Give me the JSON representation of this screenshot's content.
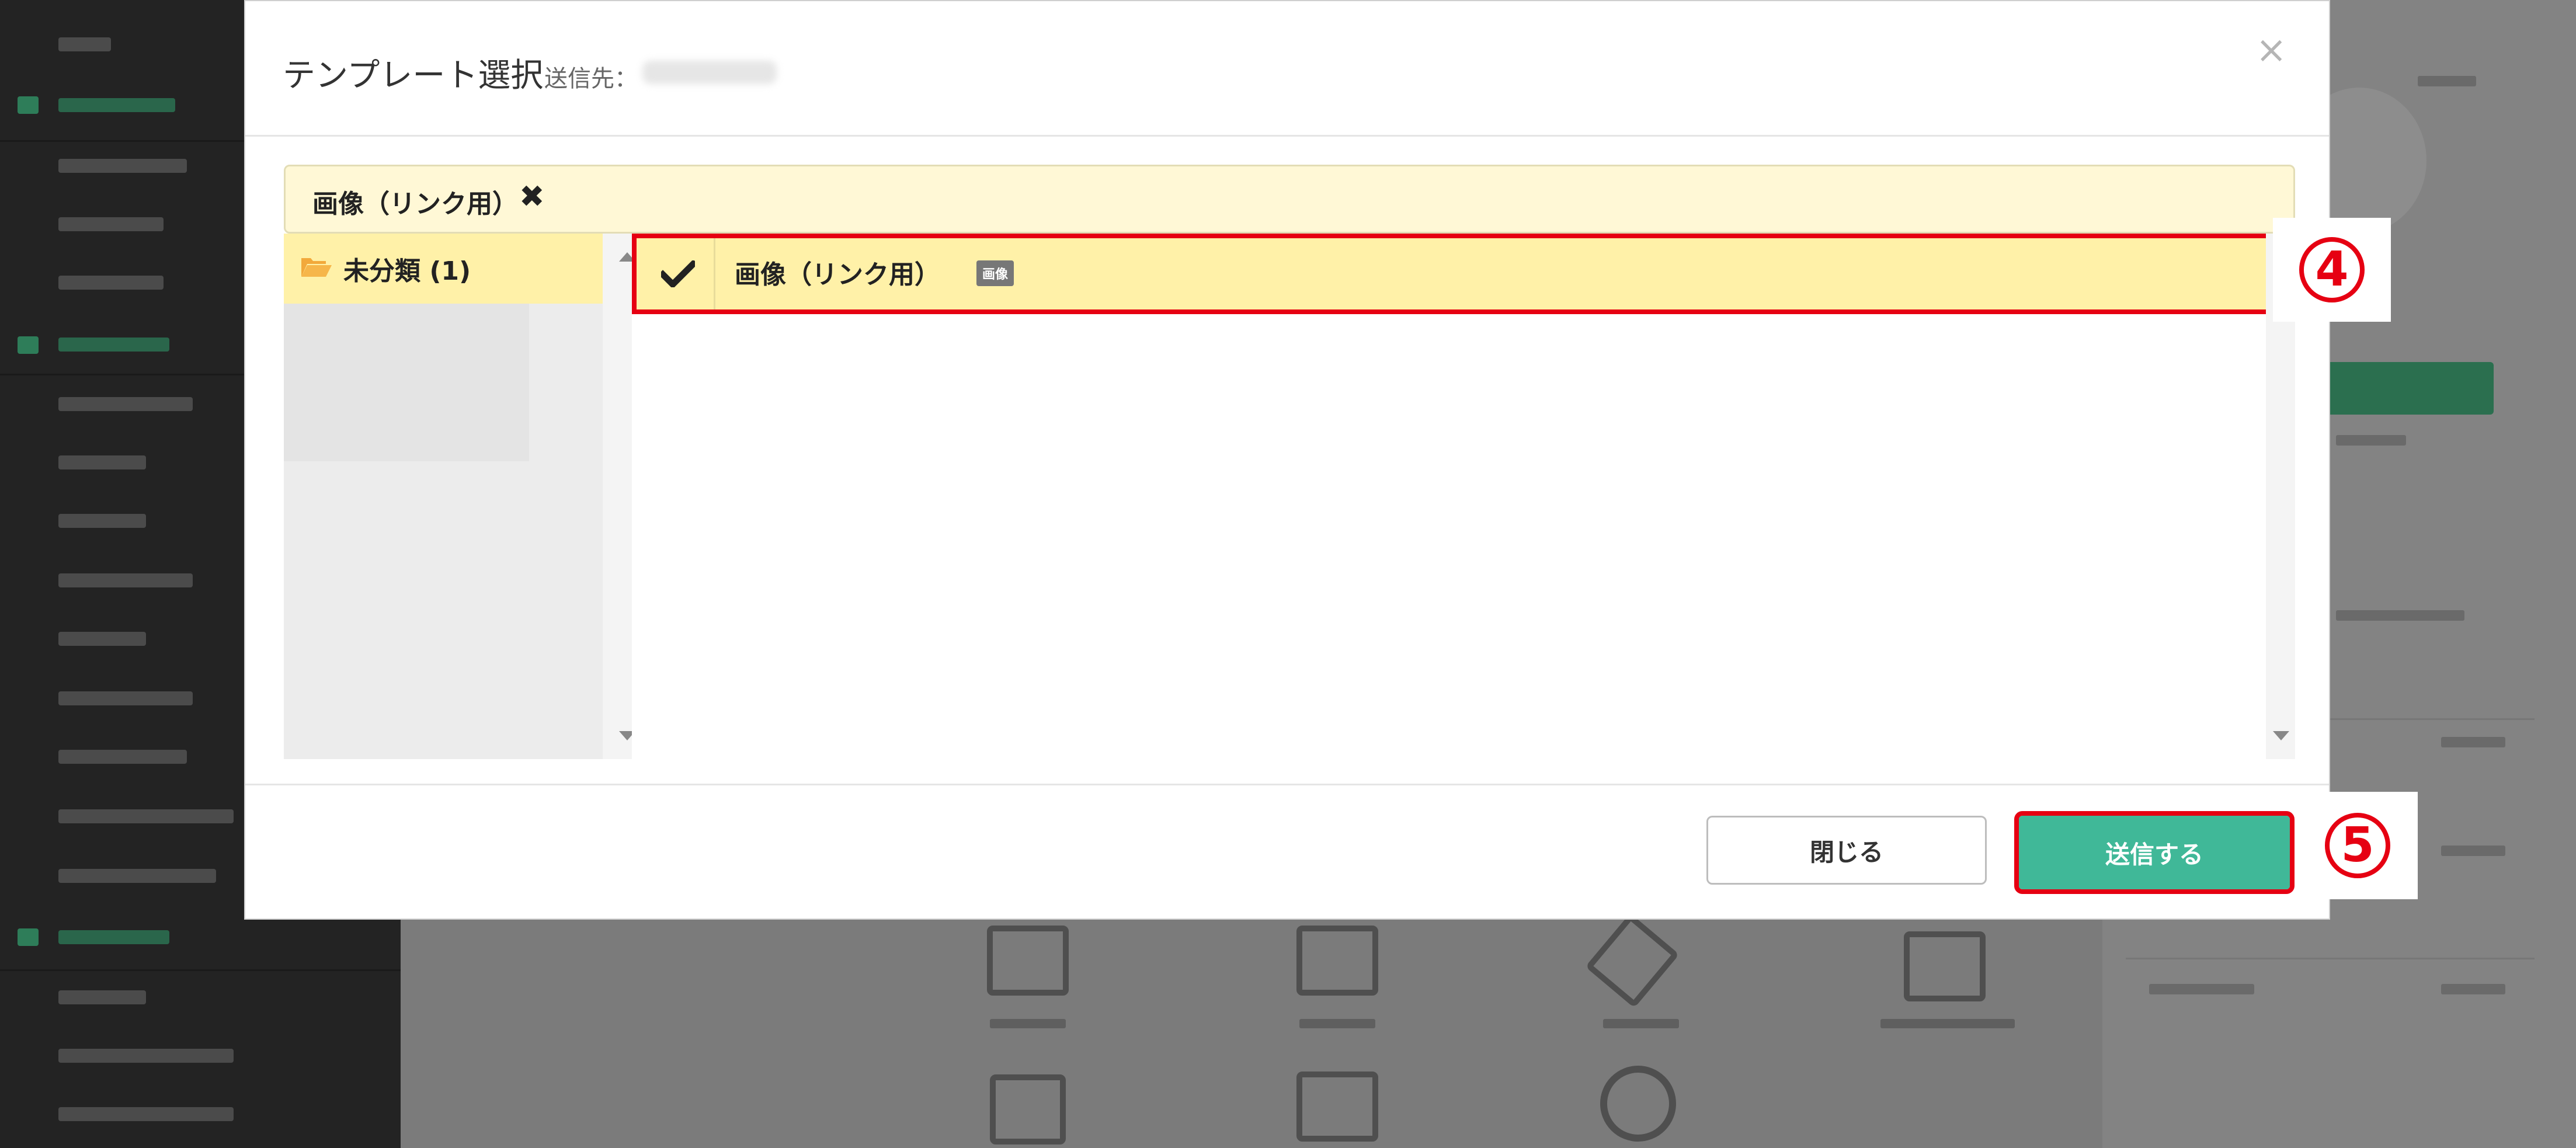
{
  "modal": {
    "title": "テンプレート選択",
    "subtitle": "送信先：",
    "close_glyph": "×"
  },
  "selected": {
    "label": "画像（リンク用）",
    "remove_glyph": "✖"
  },
  "folders": [
    {
      "label": "未分類 (1)"
    }
  ],
  "templates": [
    {
      "label": "画像（リンク用）",
      "badge": "画像",
      "checked": true
    }
  ],
  "footer": {
    "close_label": "閉じる",
    "send_label": "送信する"
  },
  "callouts": {
    "step4": "4",
    "step5": "5"
  },
  "colors": {
    "highlight": "#e60012",
    "accent": "#40b898",
    "selected_row": "#fff1a8"
  }
}
